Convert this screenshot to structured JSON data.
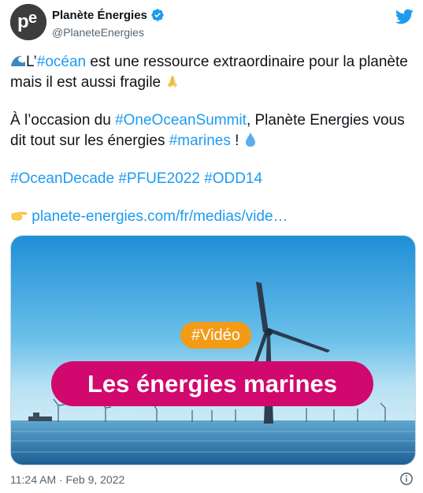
{
  "account": {
    "display_name": "Planète Énergies",
    "handle": "@PlaneteEnergies",
    "avatar_text": "pe",
    "verified": true
  },
  "tweet": {
    "line1": {
      "pre": "L’",
      "hashtag": "#océan",
      "post": " est une ressource extraordinaire pour la planète mais il est aussi fragile"
    },
    "line2": {
      "pre": "À l’occasion du ",
      "hashtag1": "#OneOceanSummit",
      "mid": ", Planète Energies vous dit tout sur les énergies ",
      "hashtag2": "#marines",
      "post": " !"
    },
    "hashtags": [
      "#OceanDecade",
      "#PFUE2022",
      "#ODD14"
    ],
    "link": "planete-energies.com/fr/medias/vide…"
  },
  "media": {
    "badge": "#Vidéo",
    "title": "Les énergies marines"
  },
  "footer": {
    "timestamp": "11:24 AM · Feb 9, 2022"
  },
  "colors": {
    "link_blue": "#1d9bf0",
    "verified_blue": "#1d9bf0",
    "badge_orange": "#f39b17",
    "title_pink": "#d1086d",
    "muted_text": "#536471"
  },
  "icons": [
    "wave-icon",
    "praying-hands-icon",
    "droplet-icon",
    "pointing-hand-icon",
    "verified-badge-icon",
    "twitter-bird-icon",
    "info-icon"
  ]
}
